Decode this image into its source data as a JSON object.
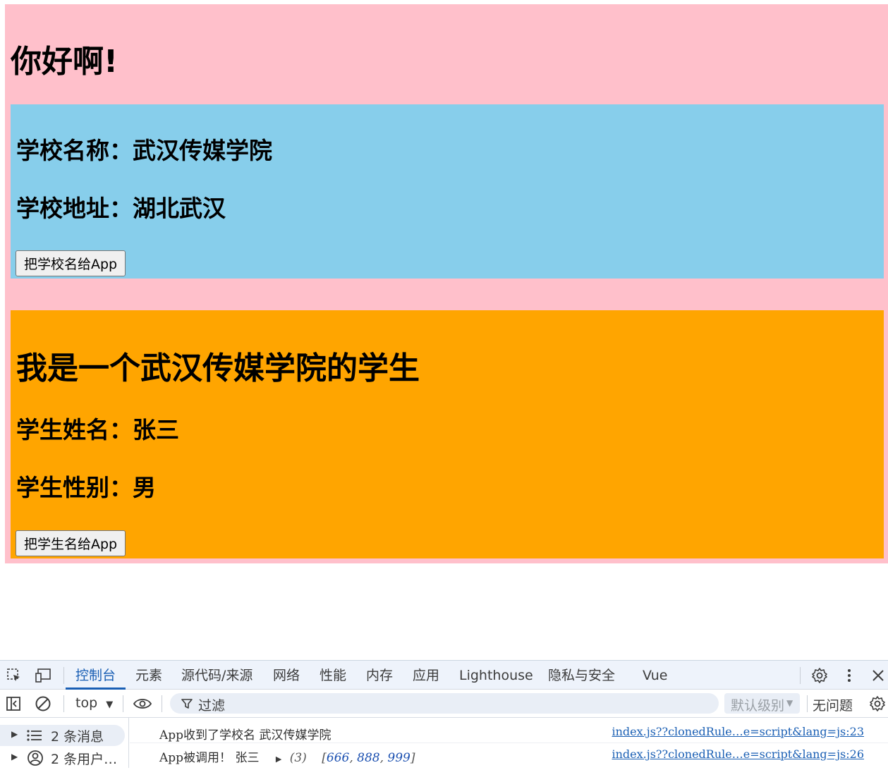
{
  "app": {
    "greeting": "你好啊!",
    "school": {
      "name_line": "学校名称：武汉传媒学院",
      "address_line": "学校地址：湖北武汉",
      "button_label": "把学校名给App"
    },
    "student": {
      "title": "我是一个武汉传媒学院的学生",
      "name_line": "学生姓名：张三",
      "gender_line": "学生性别：男",
      "button_label": "把学生名给App"
    }
  },
  "devtools": {
    "tabs": [
      {
        "label": "控制台",
        "active": true
      },
      {
        "label": "元素"
      },
      {
        "label": "源代码/来源"
      },
      {
        "label": "网络"
      },
      {
        "label": "性能"
      },
      {
        "label": "内存"
      },
      {
        "label": "应用"
      },
      {
        "label": "Lighthouse"
      },
      {
        "label": "隐私与安全"
      },
      {
        "label": "Vue"
      }
    ],
    "context": "top",
    "filter_placeholder": "过滤",
    "level": "默认级别",
    "issues": "无问题",
    "sidebar": [
      {
        "label": "2 条消息",
        "icon": "list-icon"
      },
      {
        "label": "2 条用户…",
        "icon": "user-icon"
      }
    ],
    "logs": [
      {
        "message": "App收到了学校名  武汉传媒学院",
        "source": "index.js??clonedRule…e=script&lang=js:23"
      },
      {
        "message": "App被调用！  张三",
        "array_len": "(3)",
        "array_open": "[",
        "values": [
          "666",
          "888",
          "999"
        ],
        "array_close": "]",
        "source": "index.js??clonedRule…e=script&lang=js:26"
      }
    ],
    "colors": {
      "accent": "#1a5fb4",
      "app_bg": "#ffc0cb",
      "school_bg": "#87ceeb",
      "student_bg": "#ffa500"
    }
  }
}
